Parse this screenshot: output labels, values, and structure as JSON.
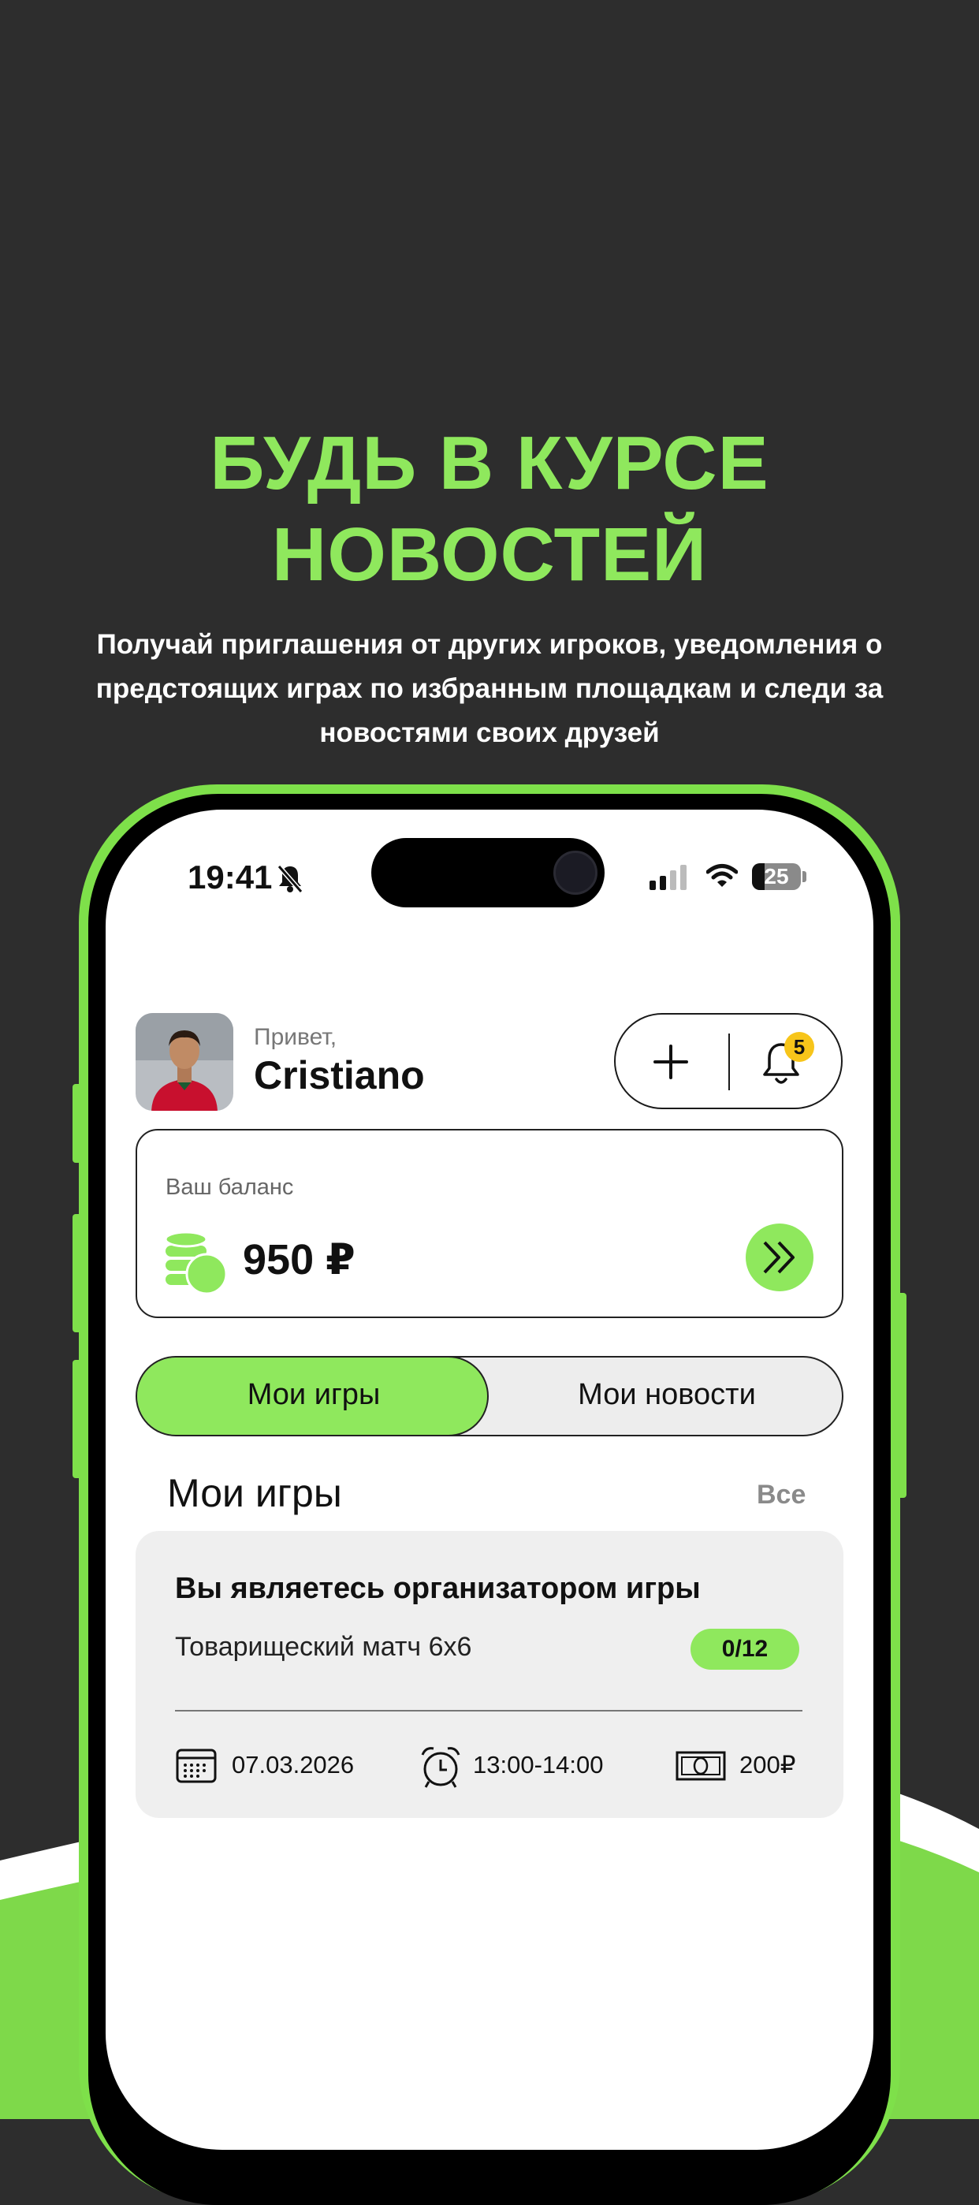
{
  "promo": {
    "headline_line1": "БУДЬ В КУРСЕ",
    "headline_line2": "НОВОСТЕЙ",
    "subtitle_line1": "Получай приглашения от других игроков, уведомления о",
    "subtitle_line2": "предстоящих играх по избранным площадкам и следи за",
    "subtitle_line3": "новостями своих друзей"
  },
  "status_bar": {
    "time": "19:41",
    "battery": "25"
  },
  "header": {
    "greeting": "Привет,",
    "username": "Cristiano",
    "notification_count": "5"
  },
  "balance": {
    "label": "Ваш баланс",
    "amount": "950 ₽"
  },
  "tabs": [
    {
      "label": "Мои игры",
      "active": true
    },
    {
      "label": "Мои новости",
      "active": false
    }
  ],
  "section": {
    "title": "Мои игры",
    "all_link": "Все"
  },
  "game_card": {
    "title": "Вы являетесь организатором игры",
    "match_name": "Товарищеский матч 6х6",
    "players": "0/12",
    "date": "07.03.2026",
    "time": "13:00-14:00",
    "price": "200₽"
  },
  "colors": {
    "accent": "#8fe85d",
    "background": "#2d2d2d",
    "phone_frame": "#7ee04a",
    "badge": "#f7c51a"
  }
}
